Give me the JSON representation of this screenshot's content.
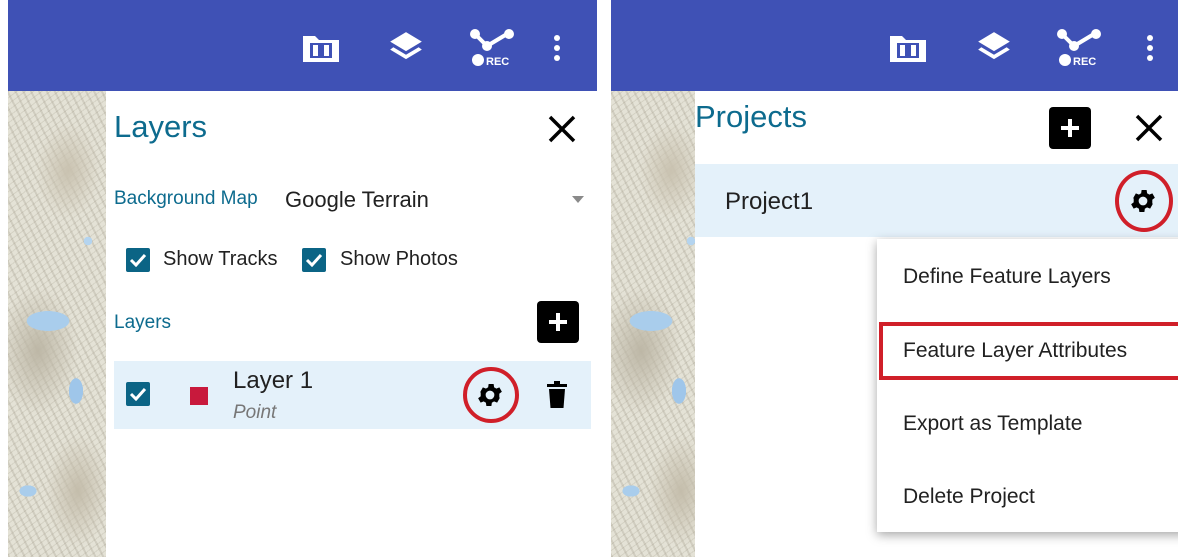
{
  "left_screen": {
    "appbar": {
      "icons": [
        "folder-icon",
        "layers-stack-icon",
        "record-track-icon",
        "overflow-menu-icon"
      ],
      "rec_label": "REC"
    },
    "panel": {
      "title": "Layers",
      "close_icon": "close-icon",
      "background_map": {
        "label": "Background Map",
        "selected": "Google Terrain"
      },
      "show_tracks": {
        "label": "Show Tracks",
        "checked": true
      },
      "show_photos": {
        "label": "Show Photos",
        "checked": true
      },
      "layers_section_label": "Layers",
      "add_layer_icon": "add-icon",
      "layers": [
        {
          "name": "Layer 1",
          "geometry": "Point",
          "checked": true,
          "color": "#c8193c"
        }
      ]
    }
  },
  "right_screen": {
    "appbar": {
      "icons": [
        "folder-icon",
        "layers-stack-icon",
        "record-track-icon",
        "overflow-menu-icon"
      ],
      "rec_label": "REC"
    },
    "panel": {
      "title": "Projects",
      "projects": [
        {
          "name": "Project1"
        }
      ],
      "context_menu": {
        "items": [
          "Define Feature Layers",
          "Feature Layer Attributes",
          "Export as Template",
          "Delete Project"
        ],
        "highlighted_index": 1
      }
    }
  },
  "colors": {
    "appbar": "#3f51b5",
    "accent": "#0d6b8e",
    "selected_row": "#e4f1fa",
    "highlight_ring": "#d01f29"
  }
}
